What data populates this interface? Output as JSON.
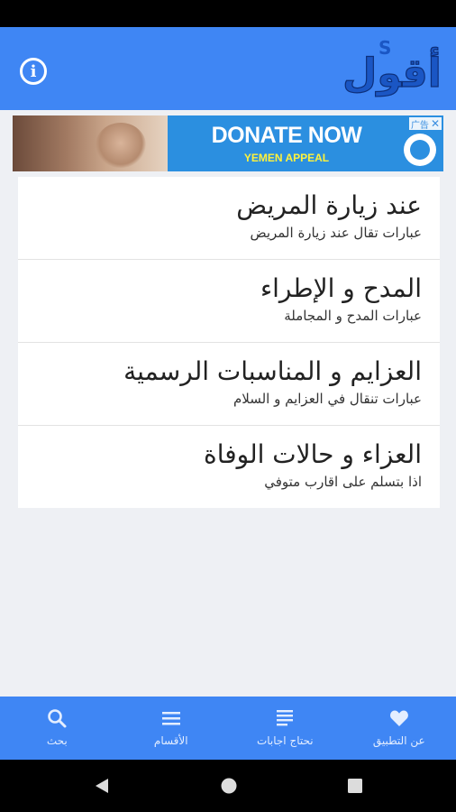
{
  "header": {
    "info_label": "i",
    "logo_text": "أقول",
    "accent_color": "#3f86f4"
  },
  "ad": {
    "title": "DONATE NOW",
    "subtitle": "YEMEN APPEAL",
    "choices_label": "广告"
  },
  "cards": [
    {
      "title": "عند زيارة المريض",
      "subtitle": "عبارات تقال عند زيارة المريض"
    },
    {
      "title": "المدح و الإطراء",
      "subtitle": "عبارات المدح و المجاملة"
    },
    {
      "title": "العزايم و المناسبات الرسمية",
      "subtitle": "عبارات تنقال في العزايم و السلام"
    },
    {
      "title": "العزاء و حالات الوفاة",
      "subtitle": "اذا بتسلم على اقارب متوفي"
    }
  ],
  "bottom_nav": [
    {
      "label": "بحث",
      "icon": "search-icon"
    },
    {
      "label": "الأقسام",
      "icon": "menu-icon"
    },
    {
      "label": "نحتاج اجابات",
      "icon": "document-icon"
    },
    {
      "label": "عن التطبيق",
      "icon": "heart-icon"
    }
  ]
}
